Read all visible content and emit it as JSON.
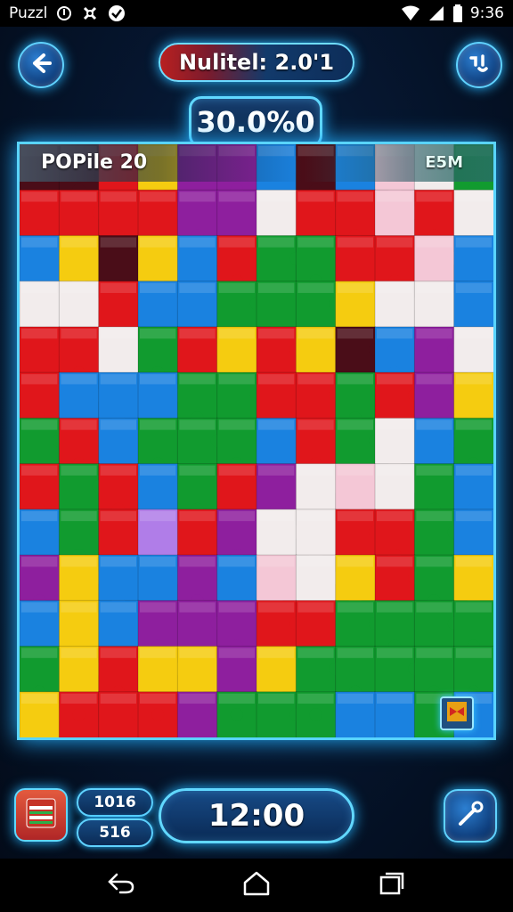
{
  "status_bar": {
    "app_label": "Puzzl",
    "time": "9:36",
    "icons": [
      "notification-icon",
      "settings-notification-icon",
      "check-circle-icon",
      "wifi-icon",
      "signal-icon",
      "battery-icon"
    ]
  },
  "header": {
    "back_icon": "back-arrow-icon",
    "title": "Nulitel: 2.0'1",
    "menu_icon": "options-icon",
    "score": "30.0%0"
  },
  "board": {
    "label_left": "POPile 20",
    "label_right": "E5M",
    "corner_icon": "piece-tray-icon",
    "colors": {
      "R": "#e0161b",
      "Y": "#f5cc10",
      "G": "#119b2f",
      "B": "#1a82e0",
      "P": "#8e1f9e",
      "W": "#f2ecec",
      "K": "#f4c7d6",
      "D": "#4a0d18",
      "L": "#b07de8"
    },
    "grid": [
      "DDRYPPBDBKWG",
      "RRRRPPWRRKRW",
      "BYDYBRGGRRKB",
      "WWRBBGGGYWWB",
      "RRWGRYRYDBPW",
      "RBBBGGRRGRPY",
      "GRBGGGBRGWBG",
      "RGRBGRPWKWGB",
      "BGRLRPWWRRGB",
      "PYBBPBKWYRGY",
      "BYBPPPRRGGGG",
      "GYRYYPYGGGGG",
      "YRRRPGGGBBGB"
    ]
  },
  "footer": {
    "box_icon": "puzzle-box-icon",
    "stat_top": "1016",
    "stat_bottom": "516",
    "timer": "12:00",
    "hint_icon": "magic-wand-icon"
  },
  "nav": {
    "back_icon": "nav-back-icon",
    "home_icon": "nav-home-icon",
    "recents_icon": "nav-recents-icon"
  }
}
